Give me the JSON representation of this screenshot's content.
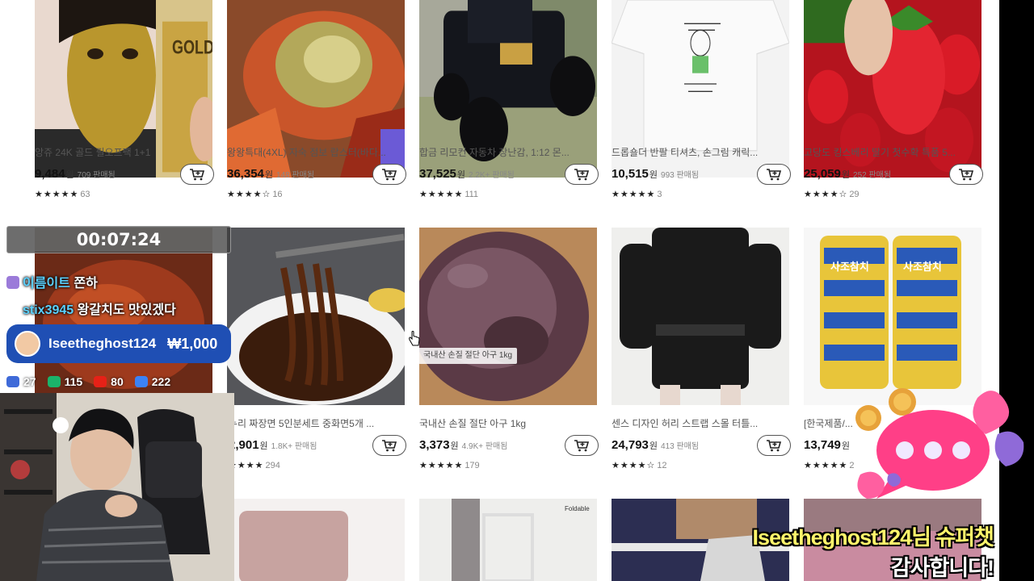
{
  "products_row1": [
    {
      "title": "앙쥬 24K 골드 필오프팩 1+1",
      "price": "9,484",
      "won": "원",
      "sold": "709 판매됨",
      "stars": "★★★★★",
      "reviews": "63"
    },
    {
      "title": "왕왕특대(4XL) 자숙 점보 랍스터(바다...",
      "price": "36,354",
      "won": "원",
      "sold": "148 판매됨",
      "stars": "★★★★☆",
      "reviews": "16"
    },
    {
      "title": "합금 리모컨 자동차 장난감, 1:12 몬...",
      "price": "37,525",
      "won": "원",
      "sold": "2.2K+ 판매됨",
      "stars": "★★★★★",
      "reviews": "111"
    },
    {
      "title": "드롭숄더 반팔 티셔츠, 손그림 캐릭...",
      "price": "10,515",
      "won": "원",
      "sold": "993 판매됨",
      "stars": "★★★★★",
      "reviews": "3"
    },
    {
      "title": "고당도 킹스베리 딸기 첫수확 특품 5...",
      "price": "25,059",
      "won": "원",
      "sold": "252 판매됨",
      "stars": "★★★★☆",
      "reviews": "29"
    }
  ],
  "products_row2": [
    {
      "title": "...",
      "price": "",
      "won": "",
      "sold": "",
      "stars": "",
      "reviews": ""
    },
    {
      "title": "누리 짜장면 5인분세트 중화면5개 ...",
      "price": "2,901",
      "won": "원",
      "sold": "1.8K+ 판매됨",
      "stars": "★★★★",
      "reviews": "294"
    },
    {
      "title": "국내산 손질 절단 아구 1kg",
      "price": "3,373",
      "won": "원",
      "sold": "4.9K+ 판매됨",
      "stars": "★★★★★",
      "reviews": "179"
    },
    {
      "title": "센스 디자인 허리 스트랩 스몰 터틀...",
      "price": "24,793",
      "won": "원",
      "sold": "413 판매됨",
      "stars": "★★★★☆",
      "reviews": "12"
    },
    {
      "title": "[한국제품/...",
      "price": "13,749",
      "won": "원",
      "sold": "",
      "stars": "★★★★★",
      "reviews": "2"
    }
  ],
  "image_caption": "국내산 손질 절단 아구 1kg",
  "tuna_can_label": "사조참치",
  "overlay": {
    "timer": "00:07:24",
    "chat": [
      {
        "user": "이름이트",
        "message": "쫀하"
      },
      {
        "user": "stix3945",
        "message": "왕갈치도 맛있겠다"
      }
    ],
    "donation": {
      "name": "Iseetheghost124",
      "amount": "₩1,000"
    },
    "stats": [
      {
        "icon": "infinity-icon",
        "value": "27",
        "color": "#3f6ad8"
      },
      {
        "icon": "chzzk-icon",
        "value": "115",
        "color": "#1bb36a"
      },
      {
        "icon": "youtube-icon",
        "value": "80",
        "color": "#e62117"
      },
      {
        "icon": "live-icon",
        "value": "222",
        "color": "#3b82f6"
      }
    ],
    "superchat_line1": "Iseetheghost124님 슈퍼챗",
    "superchat_line2": "감사합니다!"
  }
}
